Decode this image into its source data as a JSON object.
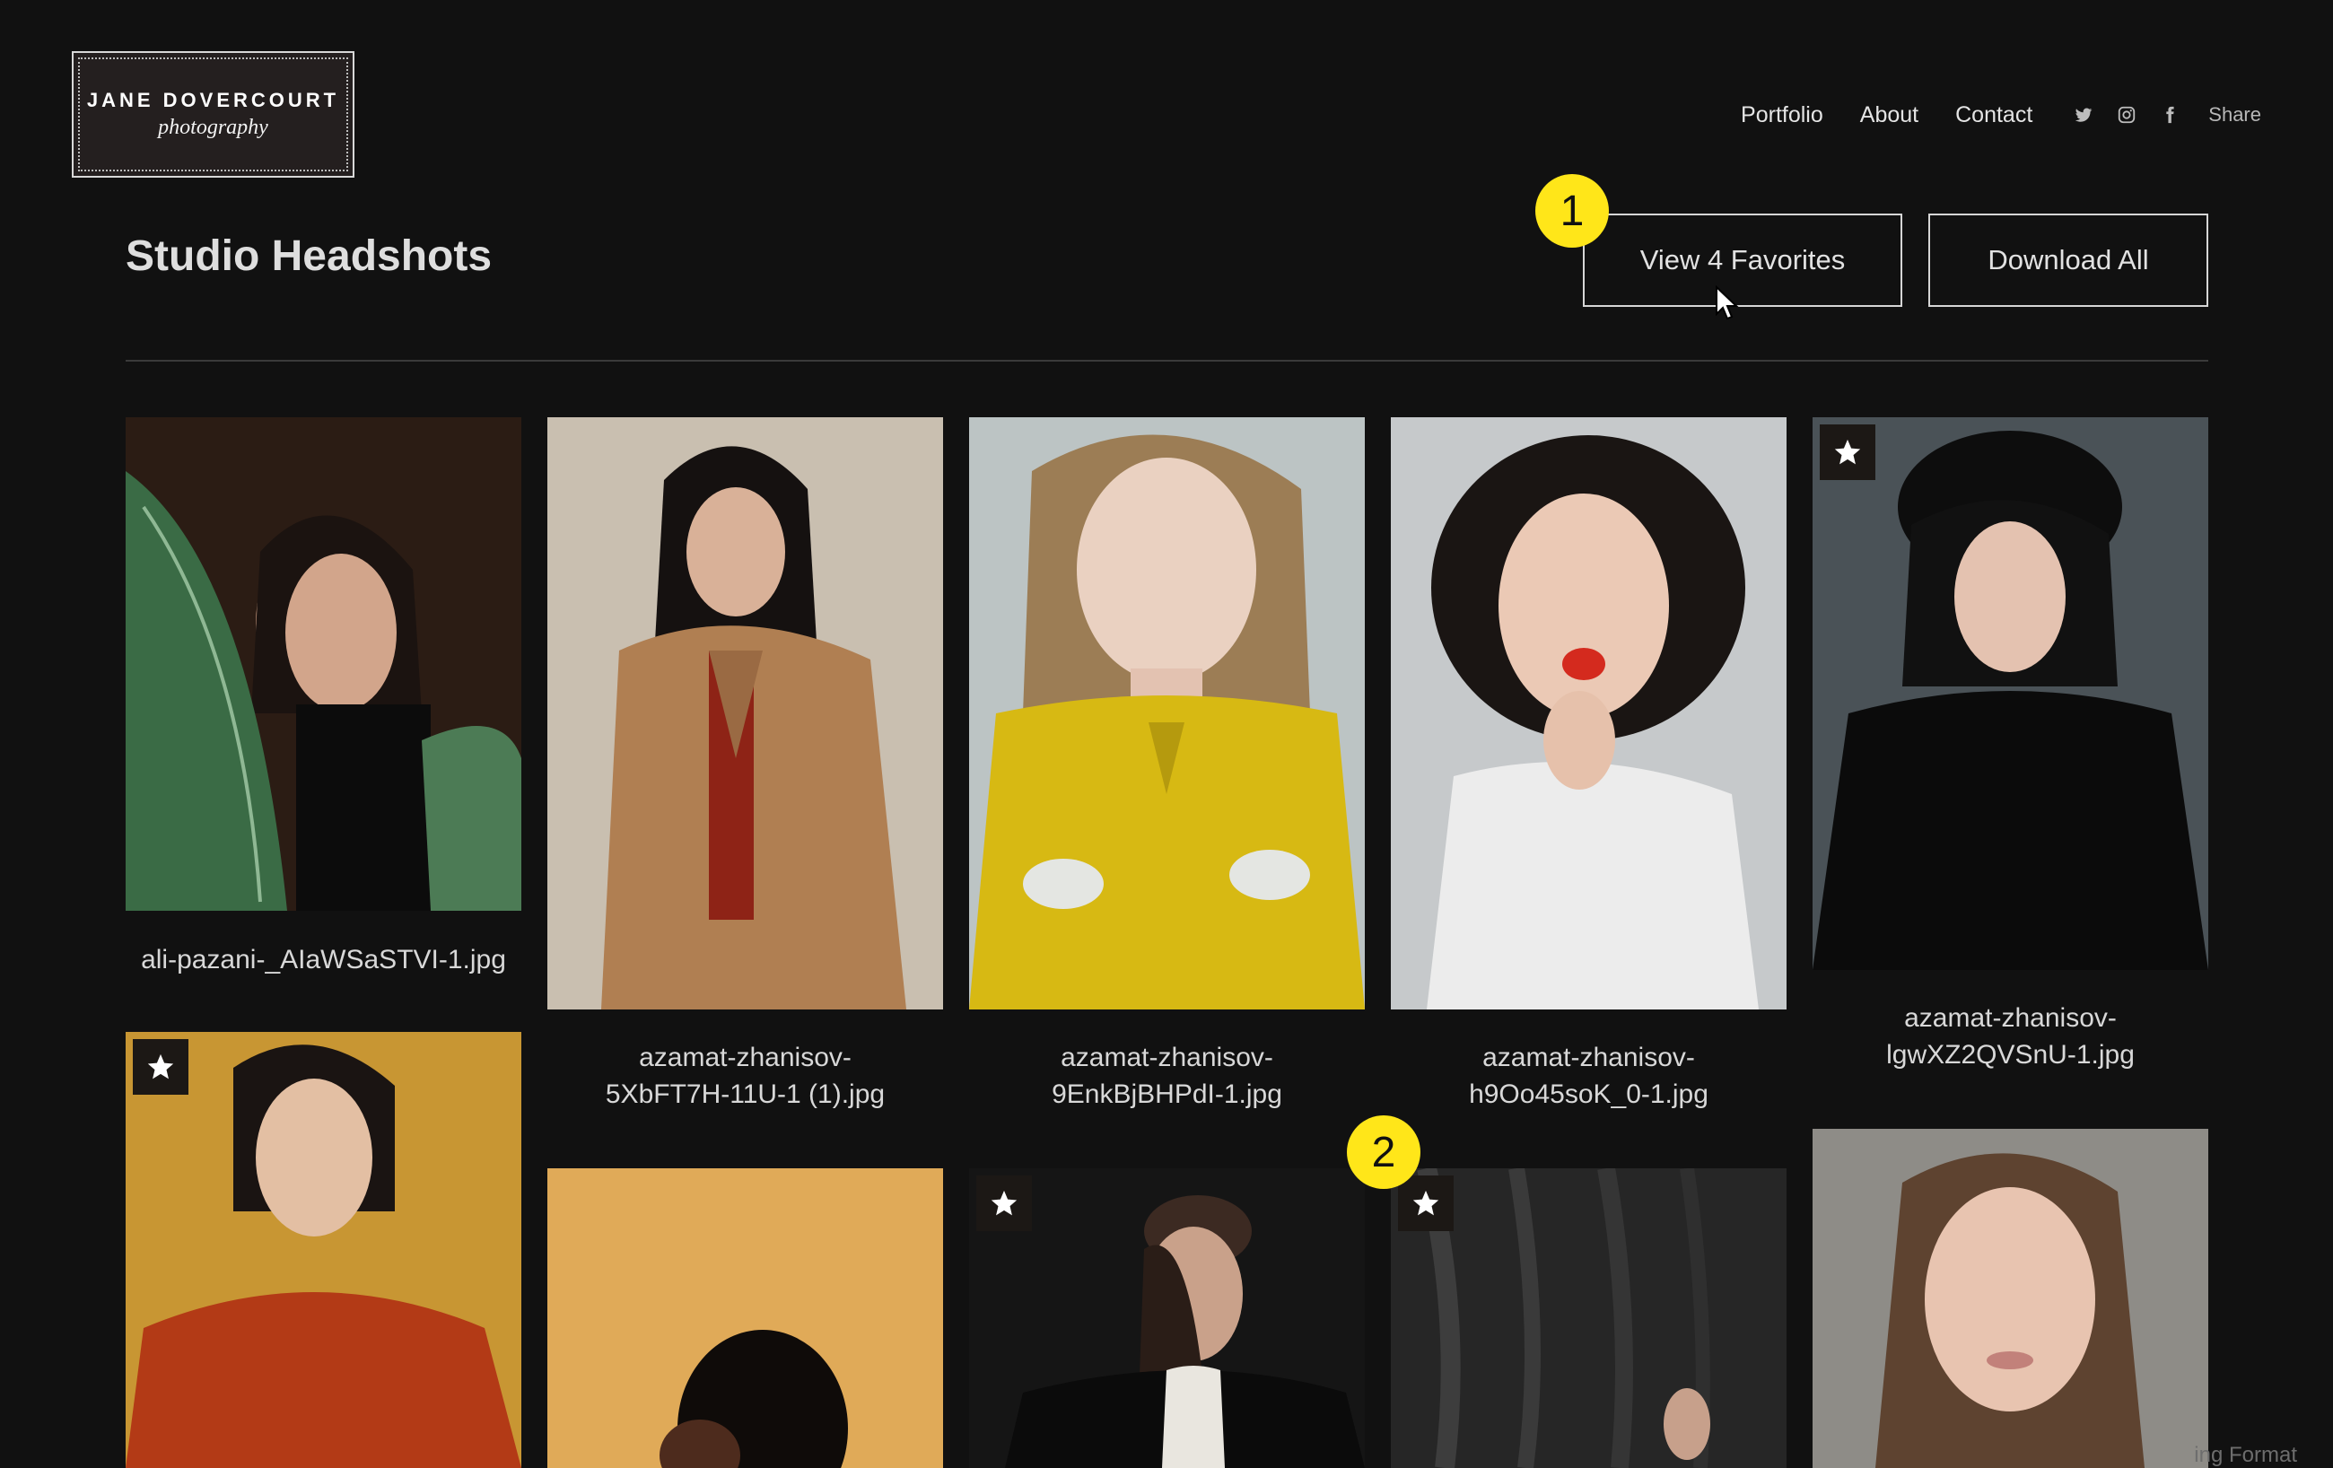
{
  "brand": {
    "name": "JANE DOVERCOURT",
    "tagline": "photography"
  },
  "nav": {
    "links": [
      "Portfolio",
      "About",
      "Contact"
    ],
    "social_icons": [
      "twitter-icon",
      "instagram-icon",
      "facebook-icon"
    ],
    "share_label": "Share"
  },
  "gallery": {
    "title": "Studio Headshots",
    "view_favorites_label": "View 4 Favorites",
    "download_all_label": "Download All",
    "photos": [
      {
        "caption_line1": "ali-pazani-_AIaWSaSTVI-1.jpg",
        "caption_line2": "",
        "favorite": false
      },
      {
        "caption_line1": "azamat-zhanisov-",
        "caption_line2": "5XbFT7H-11U-1 (1).jpg",
        "favorite": false
      },
      {
        "caption_line1": "azamat-zhanisov-",
        "caption_line2": "9EnkBjBHPdI-1.jpg",
        "favorite": false
      },
      {
        "caption_line1": "azamat-zhanisov-",
        "caption_line2": "h9Oo45soK_0-1.jpg",
        "favorite": false
      },
      {
        "caption_line1": "azamat-zhanisov-",
        "caption_line2": "lgwXZ2QVSnU-1.jpg",
        "favorite": true
      },
      {
        "caption_line1": "",
        "caption_line2": "",
        "favorite": true
      },
      {
        "caption_line1": "",
        "caption_line2": "",
        "favorite": false
      },
      {
        "caption_line1": "",
        "caption_line2": "",
        "favorite": true
      },
      {
        "caption_line1": "",
        "caption_line2": "",
        "favorite": true
      },
      {
        "caption_line1": "",
        "caption_line2": "",
        "favorite": false
      }
    ]
  },
  "annotations": {
    "marker_1": "1",
    "marker_2": "2"
  },
  "footer": {
    "watermark": "ing Format"
  },
  "colors": {
    "background": "#111111",
    "marker": "#ffe619",
    "text": "#e8e8e8"
  }
}
